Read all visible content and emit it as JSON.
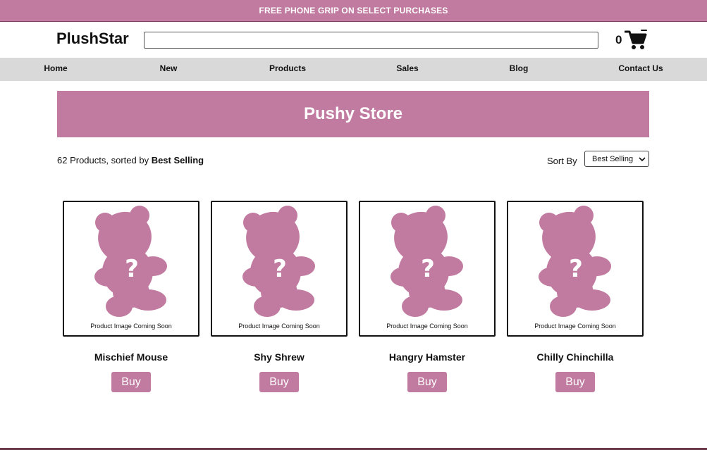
{
  "promo": {
    "text": "FREE PHONE GRIP ON SELECT PURCHASES"
  },
  "header": {
    "logo": "PlushStar",
    "search": {
      "value": "",
      "placeholder": ""
    },
    "cart": {
      "count": "0",
      "icon": "shopping-cart-icon"
    }
  },
  "nav": {
    "items": [
      {
        "label": "Home"
      },
      {
        "label": "New"
      },
      {
        "label": "Products"
      },
      {
        "label": "Sales"
      },
      {
        "label": "Blog"
      },
      {
        "label": "Contact Us"
      }
    ]
  },
  "hero": {
    "title": "Pushy Store"
  },
  "results": {
    "summary_prefix": "62 Products, sorted by ",
    "summary_sort": "Best Selling",
    "sort_label": "Sort By",
    "sort_selected": "Best Selling"
  },
  "products": [
    {
      "name": "Mischief Mouse",
      "image_caption": "Product Image Coming Soon",
      "placeholder_glyph": "?",
      "buy_label": "Buy"
    },
    {
      "name": "Shy Shrew",
      "image_caption": "Product Image Coming Soon",
      "placeholder_glyph": "?",
      "buy_label": "Buy"
    },
    {
      "name": "Hangry Hamster",
      "image_caption": "Product Image Coming Soon",
      "placeholder_glyph": "?",
      "buy_label": "Buy"
    },
    {
      "name": "Chilly Chinchilla",
      "image_caption": "Product Image Coming Soon",
      "placeholder_glyph": "?",
      "buy_label": "Buy"
    }
  ],
  "colors": {
    "accent": "#c17aa0",
    "nav_background": "#d9d9d9",
    "text": "#111111"
  }
}
